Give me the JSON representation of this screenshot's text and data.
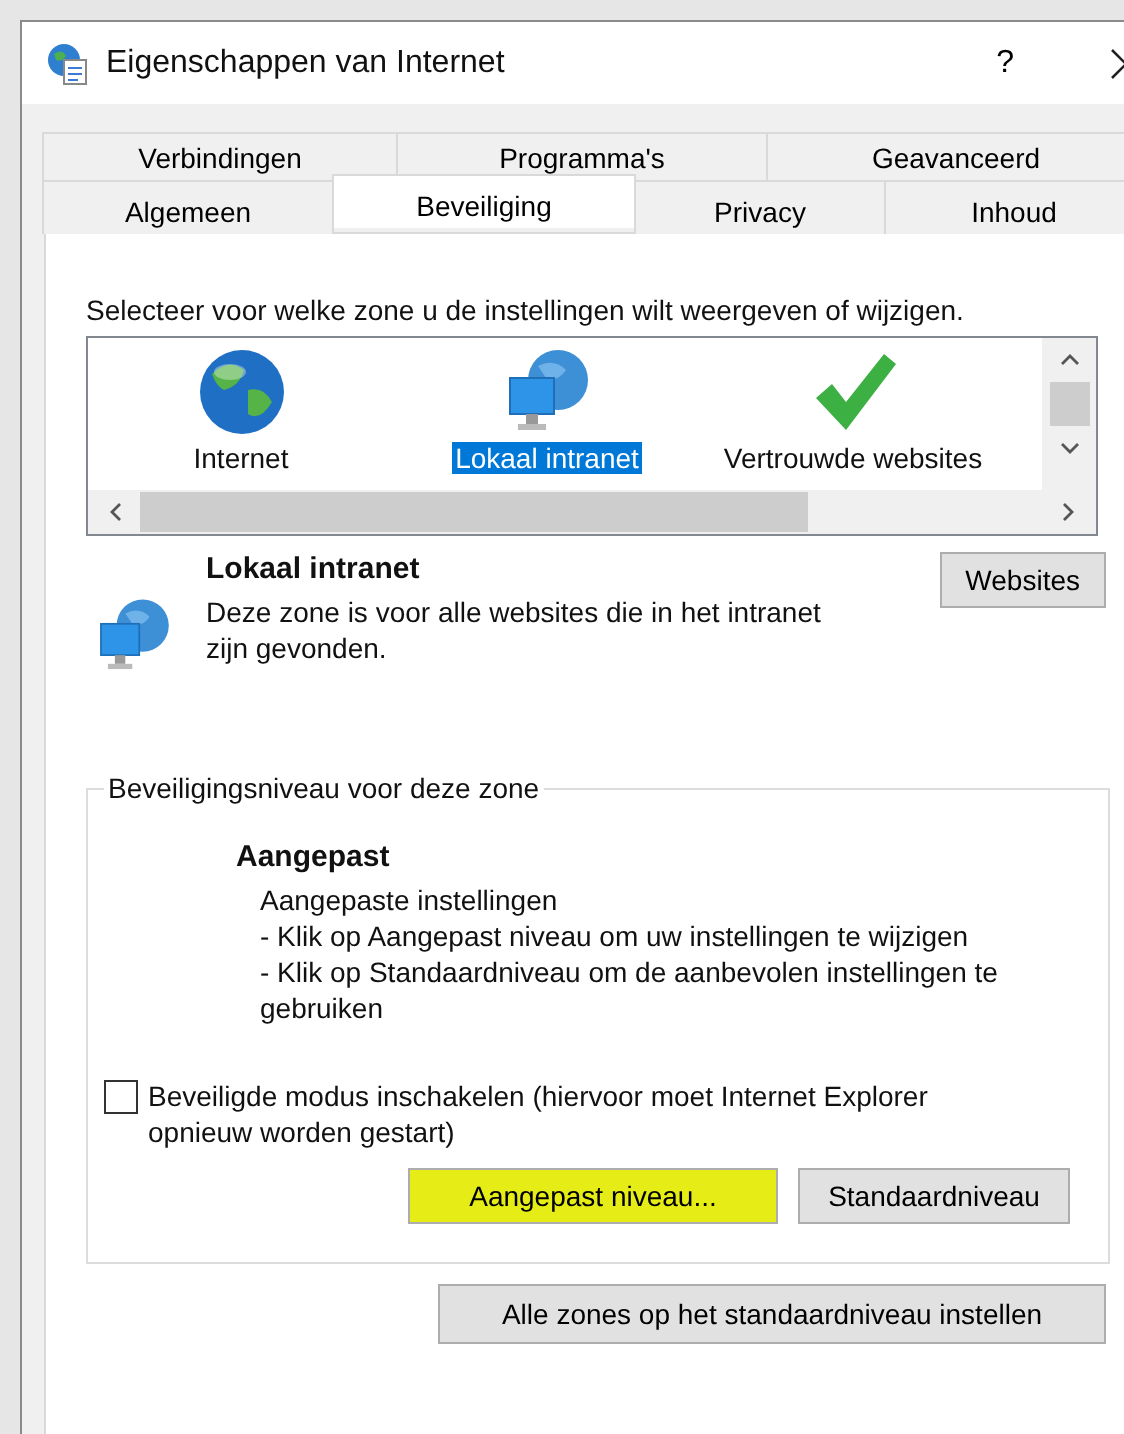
{
  "window": {
    "title": "Eigenschappen van Internet",
    "help_button": "?"
  },
  "tab_rows": [
    {
      "tabs": [
        {
          "label": "Verbindingen",
          "selected": false
        },
        {
          "label": "Programma's",
          "selected": false
        },
        {
          "label": "Geavanceerd",
          "selected": false
        }
      ]
    },
    {
      "tabs": [
        {
          "label": "Algemeen",
          "selected": false
        },
        {
          "label": "Beveiliging",
          "selected": true
        },
        {
          "label": "Privacy",
          "selected": false
        },
        {
          "label": "Inhoud",
          "selected": false
        }
      ]
    }
  ],
  "zone_prompt": "Selecteer voor welke zone u de instellingen wilt weergeven of wijzigen.",
  "zones": [
    {
      "kind": "globe",
      "label": "Internet",
      "selected": false
    },
    {
      "kind": "intranet",
      "label": "Lokaal intranet",
      "selected": true
    },
    {
      "kind": "check",
      "label": "Vertrouwde websites",
      "selected": false
    }
  ],
  "zone_details": {
    "title": "Lokaal intranet",
    "description": "Deze zone is voor alle websites die in het intranet zijn gevonden.",
    "button": "Websites"
  },
  "security_level": {
    "legend": "Beveiligingsniveau voor deze zone",
    "level_name": "Aangepast",
    "lines": [
      "Aangepaste instellingen",
      "- Klik op Aangepast niveau om uw instellingen te wijzigen",
      "- Klik op Standaardniveau om de aanbevolen instellingen te gebruiken"
    ],
    "protected_mode": {
      "label": "Beveiligde modus inschakelen (hiervoor moet Internet Explorer opnieuw worden gestart)",
      "checked": false
    },
    "buttons": [
      {
        "label": "Aangepast niveau...",
        "highlighted": true
      },
      {
        "label": "Standaardniveau",
        "highlighted": false
      }
    ]
  },
  "reset_button": "Alle zones op het standaardniveau instellen"
}
